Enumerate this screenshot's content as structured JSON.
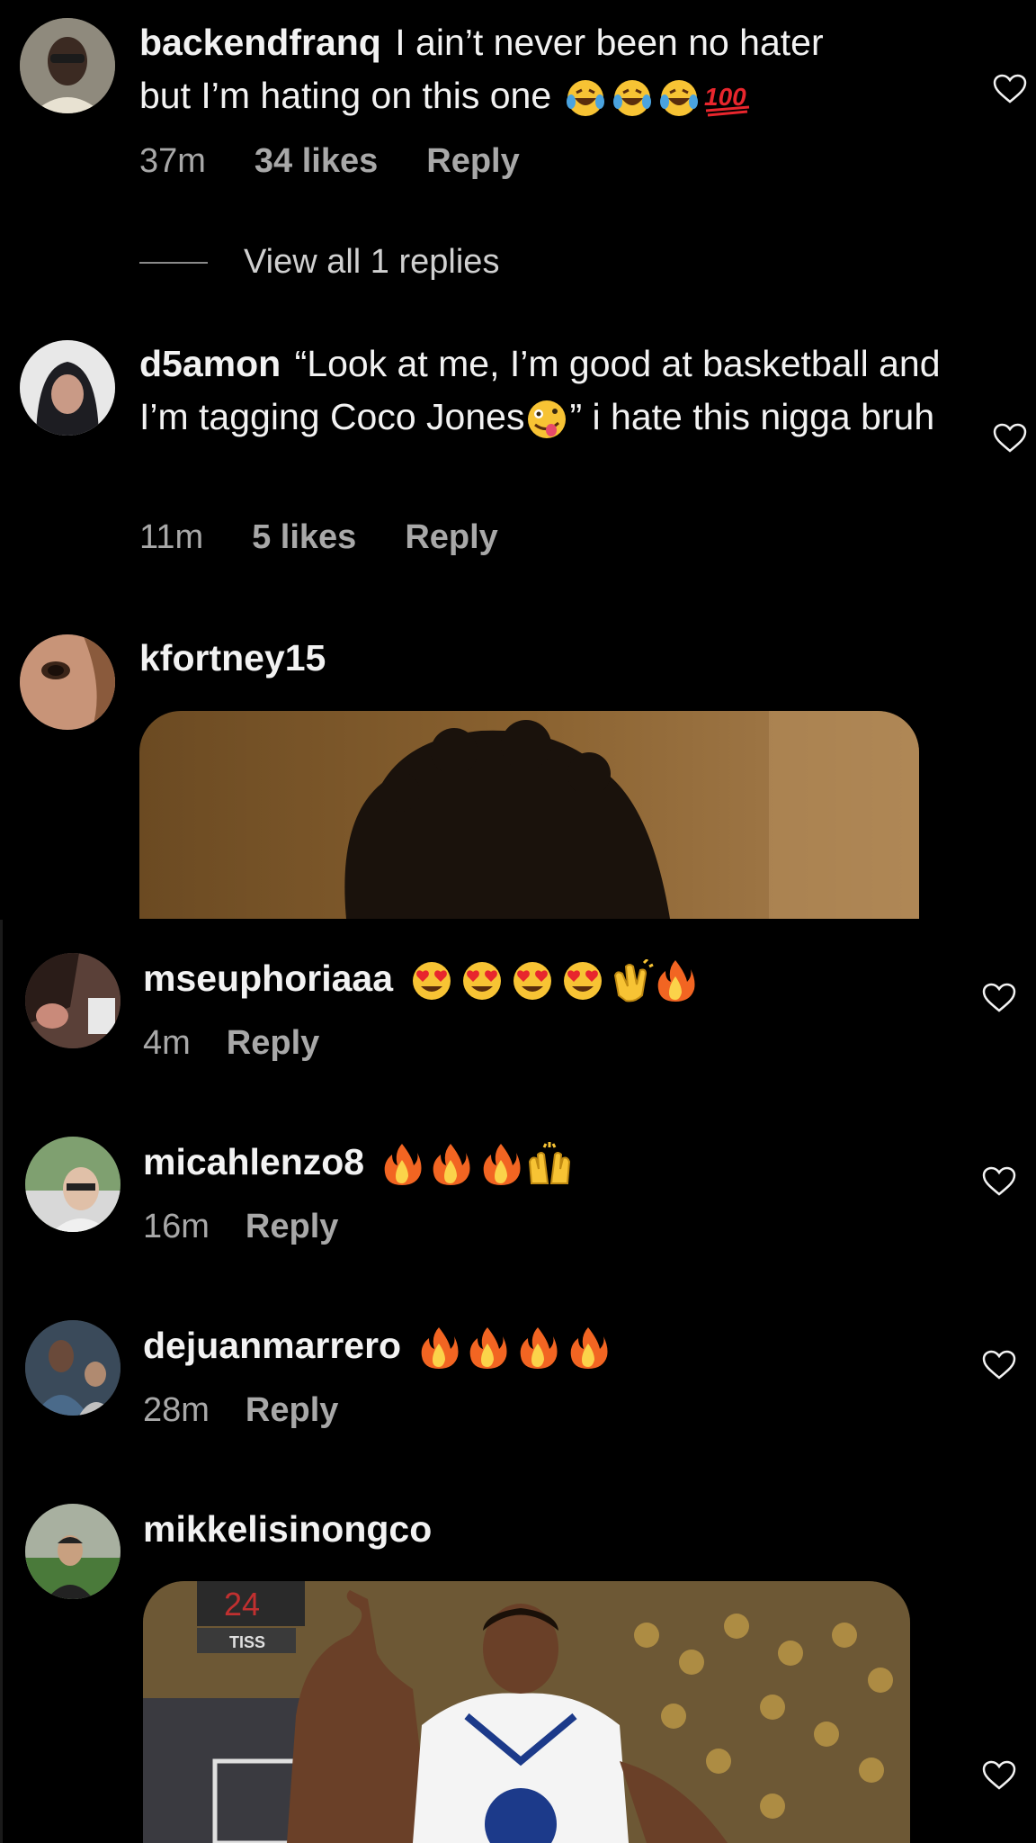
{
  "comments": [
    {
      "username": "backendfranq",
      "text": "I ain’t never been no hater but I’m hating on this one",
      "emoji": [
        "laugh-cry-emoji",
        "laugh-cry-emoji",
        "laugh-cry-emoji",
        "hundred-emoji"
      ],
      "time": "37m",
      "likes": "34 likes",
      "reply": "Reply",
      "view_replies": "View all 1 replies"
    },
    {
      "username": "d5amon",
      "text_part1": "“Look at me, I’m good at basketball and I’m tagging Coco Jones",
      "emoji": [
        "zany-face-emoji"
      ],
      "text_part2": "” i hate this nigga bruh",
      "time": "11m",
      "likes": "5 likes",
      "reply": "Reply"
    },
    {
      "username": "kfortney15"
    },
    {
      "username": "mseuphoriaaa",
      "emoji": [
        "heart-eyes-emoji",
        "heart-eyes-emoji",
        "heart-eyes-emoji",
        "heart-eyes-emoji",
        "clapping-hands-emoji",
        "fire-emoji"
      ],
      "time": "4m",
      "reply": "Reply"
    },
    {
      "username": "micahlenzo8",
      "emoji": [
        "fire-emoji",
        "fire-emoji",
        "fire-emoji",
        "raising-hands-emoji"
      ],
      "time": "16m",
      "reply": "Reply"
    },
    {
      "username": "dejuanmarrero",
      "emoji": [
        "fire-emoji",
        "fire-emoji",
        "fire-emoji",
        "fire-emoji"
      ],
      "time": "28m",
      "reply": "Reply"
    },
    {
      "username": "mikkelisinongco",
      "gif_scoreboard": "24",
      "gif_sponsor": "TISS"
    }
  ],
  "colors": {
    "background": "#000000",
    "meta_text": "#a8a8a8",
    "primary_text": "#f2f2f2"
  }
}
